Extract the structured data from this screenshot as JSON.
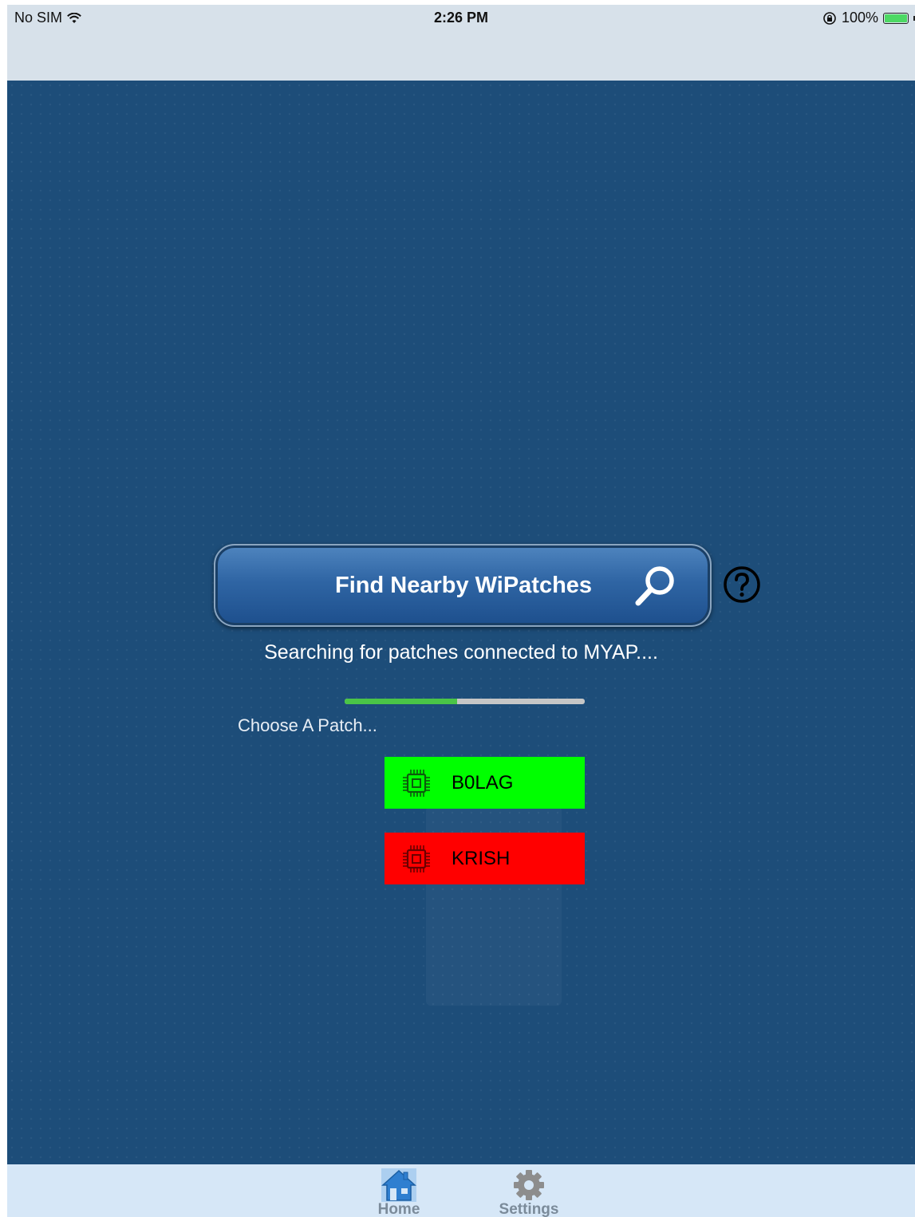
{
  "status_bar": {
    "carrier": "No SIM",
    "time": "2:26 PM",
    "battery": "100%"
  },
  "main": {
    "find_button_label": "Find Nearby WiPatches",
    "searching_text": "Searching for patches connected to MYAP....",
    "progress_fraction": 0.47,
    "choose_label": "Choose A Patch...",
    "patches": [
      {
        "name": "B0LAG",
        "color": "#00ff00",
        "icon": "chip-icon"
      },
      {
        "name": "KRISH",
        "color": "#ff0000",
        "icon": "chip-icon"
      }
    ]
  },
  "tab_bar": {
    "tabs": [
      {
        "label": "Home",
        "icon": "home-icon",
        "selected": true
      },
      {
        "label": "Settings",
        "icon": "gear-icon",
        "selected": false
      }
    ]
  },
  "colors": {
    "background": "#1d4d79",
    "status_bar": "#d7e1ea",
    "tab_bar": "#d6e7f7",
    "progress_fill": "#4ac547",
    "progress_track": "#c6c6c6"
  }
}
